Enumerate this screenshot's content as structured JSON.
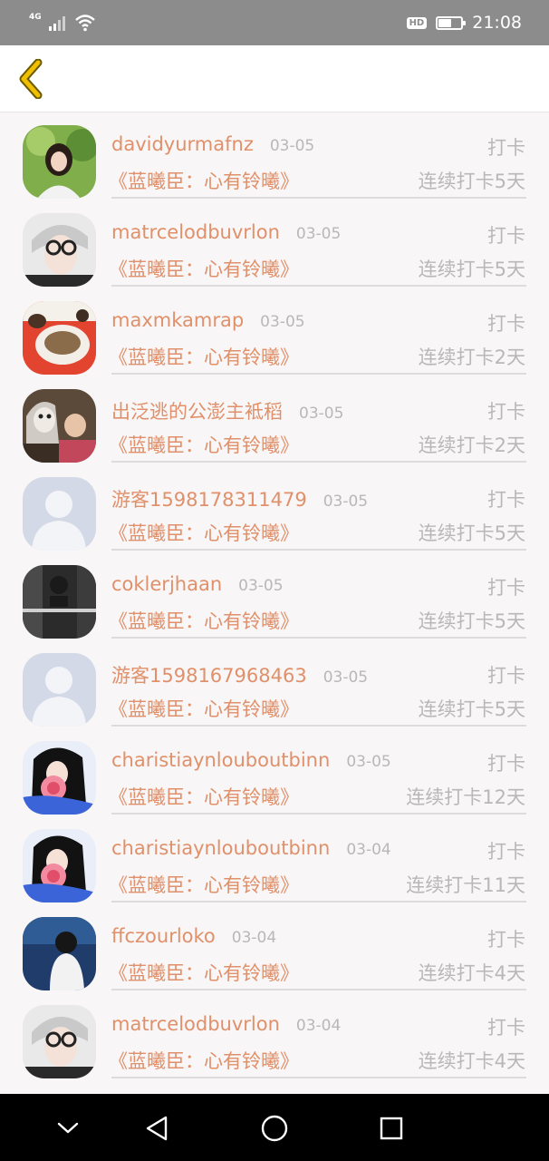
{
  "status_bar": {
    "network": "4G",
    "hd_badge": "HD",
    "battery_level": 0.6,
    "time": "21:08"
  },
  "colors": {
    "accent": "#e0906a",
    "muted_text": "#b8b8b8",
    "back_icon": "#e6b100"
  },
  "header": {
    "back_icon": "chevron-left-icon"
  },
  "checkins": [
    {
      "name": "davidyurmafnz",
      "date": "03-05",
      "action": "打卡",
      "book": "《蓝曦臣：心有铃曦》",
      "streak": "连续打卡5天"
    },
    {
      "name": "matrcelodbuvrlon",
      "date": "03-05",
      "action": "打卡",
      "book": "《蓝曦臣：心有铃曦》",
      "streak": "连续打卡5天"
    },
    {
      "name": "maxmkamrap",
      "date": "03-05",
      "action": "打卡",
      "book": "《蓝曦臣：心有铃曦》",
      "streak": "连续打卡2天"
    },
    {
      "name": "出泛逃的公澎主袛稻",
      "date": "03-05",
      "action": "打卡",
      "book": "《蓝曦臣：心有铃曦》",
      "streak": "连续打卡2天"
    },
    {
      "name": "游客1598178311479",
      "date": "03-05",
      "action": "打卡",
      "book": "《蓝曦臣：心有铃曦》",
      "streak": "连续打卡5天"
    },
    {
      "name": "coklerjhaan",
      "date": "03-05",
      "action": "打卡",
      "book": "《蓝曦臣：心有铃曦》",
      "streak": "连续打卡5天"
    },
    {
      "name": "游客1598167968463",
      "date": "03-05",
      "action": "打卡",
      "book": "《蓝曦臣：心有铃曦》",
      "streak": "连续打卡5天"
    },
    {
      "name": "charistiaynlouboutbinn",
      "date": "03-05",
      "action": "打卡",
      "book": "《蓝曦臣：心有铃曦》",
      "streak": "连续打卡12天"
    },
    {
      "name": "charistiaynlouboutbinn",
      "date": "03-04",
      "action": "打卡",
      "book": "《蓝曦臣：心有铃曦》",
      "streak": "连续打卡11天"
    },
    {
      "name": "ffczourloko",
      "date": "03-04",
      "action": "打卡",
      "book": "《蓝曦臣：心有铃曦》",
      "streak": "连续打卡4天"
    },
    {
      "name": "matrcelodbuvrlon",
      "date": "03-04",
      "action": "打卡",
      "book": "《蓝曦臣：心有铃曦》",
      "streak": "连续打卡4天"
    }
  ],
  "nav_bar": {
    "buttons": [
      "chevron-down-icon",
      "back-triangle-icon",
      "home-circle-icon",
      "recents-square-icon"
    ]
  }
}
